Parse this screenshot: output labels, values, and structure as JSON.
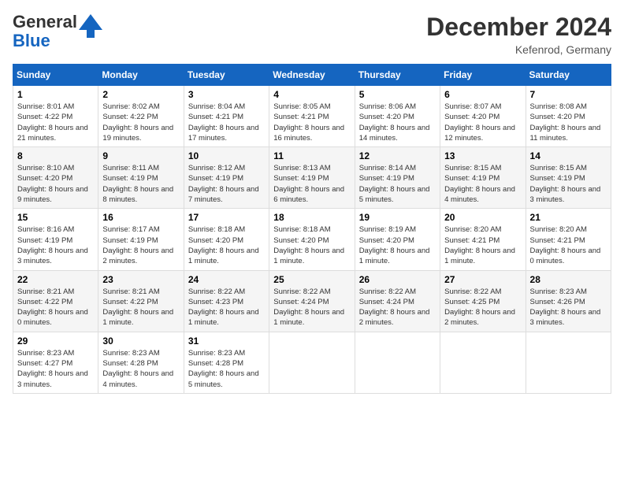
{
  "header": {
    "logo_general": "General",
    "logo_blue": "Blue",
    "month_title": "December 2024",
    "location": "Kefenrod, Germany"
  },
  "weekdays": [
    "Sunday",
    "Monday",
    "Tuesday",
    "Wednesday",
    "Thursday",
    "Friday",
    "Saturday"
  ],
  "weeks": [
    [
      {
        "day": "1",
        "sunrise": "8:01 AM",
        "sunset": "4:22 PM",
        "daylight": "8 hours and 21 minutes."
      },
      {
        "day": "2",
        "sunrise": "8:02 AM",
        "sunset": "4:22 PM",
        "daylight": "8 hours and 19 minutes."
      },
      {
        "day": "3",
        "sunrise": "8:04 AM",
        "sunset": "4:21 PM",
        "daylight": "8 hours and 17 minutes."
      },
      {
        "day": "4",
        "sunrise": "8:05 AM",
        "sunset": "4:21 PM",
        "daylight": "8 hours and 16 minutes."
      },
      {
        "day": "5",
        "sunrise": "8:06 AM",
        "sunset": "4:20 PM",
        "daylight": "8 hours and 14 minutes."
      },
      {
        "day": "6",
        "sunrise": "8:07 AM",
        "sunset": "4:20 PM",
        "daylight": "8 hours and 12 minutes."
      },
      {
        "day": "7",
        "sunrise": "8:08 AM",
        "sunset": "4:20 PM",
        "daylight": "8 hours and 11 minutes."
      }
    ],
    [
      {
        "day": "8",
        "sunrise": "8:10 AM",
        "sunset": "4:20 PM",
        "daylight": "8 hours and 9 minutes."
      },
      {
        "day": "9",
        "sunrise": "8:11 AM",
        "sunset": "4:19 PM",
        "daylight": "8 hours and 8 minutes."
      },
      {
        "day": "10",
        "sunrise": "8:12 AM",
        "sunset": "4:19 PM",
        "daylight": "8 hours and 7 minutes."
      },
      {
        "day": "11",
        "sunrise": "8:13 AM",
        "sunset": "4:19 PM",
        "daylight": "8 hours and 6 minutes."
      },
      {
        "day": "12",
        "sunrise": "8:14 AM",
        "sunset": "4:19 PM",
        "daylight": "8 hours and 5 minutes."
      },
      {
        "day": "13",
        "sunrise": "8:15 AM",
        "sunset": "4:19 PM",
        "daylight": "8 hours and 4 minutes."
      },
      {
        "day": "14",
        "sunrise": "8:15 AM",
        "sunset": "4:19 PM",
        "daylight": "8 hours and 3 minutes."
      }
    ],
    [
      {
        "day": "15",
        "sunrise": "8:16 AM",
        "sunset": "4:19 PM",
        "daylight": "8 hours and 3 minutes."
      },
      {
        "day": "16",
        "sunrise": "8:17 AM",
        "sunset": "4:19 PM",
        "daylight": "8 hours and 2 minutes."
      },
      {
        "day": "17",
        "sunrise": "8:18 AM",
        "sunset": "4:20 PM",
        "daylight": "8 hours and 1 minute."
      },
      {
        "day": "18",
        "sunrise": "8:18 AM",
        "sunset": "4:20 PM",
        "daylight": "8 hours and 1 minute."
      },
      {
        "day": "19",
        "sunrise": "8:19 AM",
        "sunset": "4:20 PM",
        "daylight": "8 hours and 1 minute."
      },
      {
        "day": "20",
        "sunrise": "8:20 AM",
        "sunset": "4:21 PM",
        "daylight": "8 hours and 1 minute."
      },
      {
        "day": "21",
        "sunrise": "8:20 AM",
        "sunset": "4:21 PM",
        "daylight": "8 hours and 0 minutes."
      }
    ],
    [
      {
        "day": "22",
        "sunrise": "8:21 AM",
        "sunset": "4:22 PM",
        "daylight": "8 hours and 0 minutes."
      },
      {
        "day": "23",
        "sunrise": "8:21 AM",
        "sunset": "4:22 PM",
        "daylight": "8 hours and 1 minute."
      },
      {
        "day": "24",
        "sunrise": "8:22 AM",
        "sunset": "4:23 PM",
        "daylight": "8 hours and 1 minute."
      },
      {
        "day": "25",
        "sunrise": "8:22 AM",
        "sunset": "4:24 PM",
        "daylight": "8 hours and 1 minute."
      },
      {
        "day": "26",
        "sunrise": "8:22 AM",
        "sunset": "4:24 PM",
        "daylight": "8 hours and 2 minutes."
      },
      {
        "day": "27",
        "sunrise": "8:22 AM",
        "sunset": "4:25 PM",
        "daylight": "8 hours and 2 minutes."
      },
      {
        "day": "28",
        "sunrise": "8:23 AM",
        "sunset": "4:26 PM",
        "daylight": "8 hours and 3 minutes."
      }
    ],
    [
      {
        "day": "29",
        "sunrise": "8:23 AM",
        "sunset": "4:27 PM",
        "daylight": "8 hours and 3 minutes."
      },
      {
        "day": "30",
        "sunrise": "8:23 AM",
        "sunset": "4:28 PM",
        "daylight": "8 hours and 4 minutes."
      },
      {
        "day": "31",
        "sunrise": "8:23 AM",
        "sunset": "4:28 PM",
        "daylight": "8 hours and 5 minutes."
      },
      null,
      null,
      null,
      null
    ]
  ]
}
